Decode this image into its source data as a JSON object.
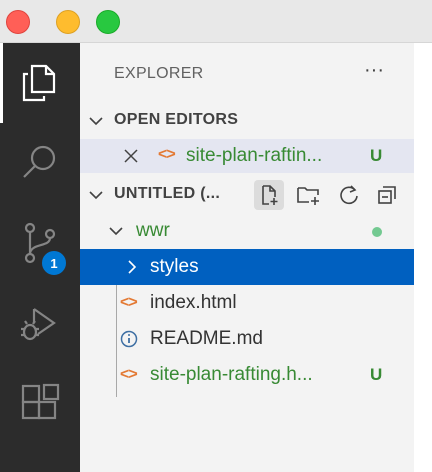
{
  "explorer": {
    "title": "EXPLORER",
    "more_label": "···"
  },
  "open_editors": {
    "title": "OPEN EDITORS",
    "items": [
      {
        "name": "site-plan-raftin...",
        "status": "U"
      }
    ]
  },
  "workspace": {
    "title": "UNTITLED (...",
    "actions": [
      "new-file",
      "new-folder",
      "refresh",
      "collapse-all"
    ]
  },
  "tree": {
    "folder": {
      "name": "wwr",
      "modified": true
    },
    "items": [
      {
        "name": "styles",
        "kind": "folder",
        "selected": true
      },
      {
        "name": "index.html",
        "kind": "html"
      },
      {
        "name": "README.md",
        "kind": "info"
      },
      {
        "name": "site-plan-rafting.h...",
        "kind": "html",
        "status": "U"
      }
    ]
  },
  "activity": {
    "source_control_badge": "1"
  },
  "colors": {
    "untracked": "#388a34",
    "selection": "#0060c0",
    "badge": "#0078d4",
    "html_icon": "#e37933",
    "info_icon": "#3e6fa3"
  }
}
